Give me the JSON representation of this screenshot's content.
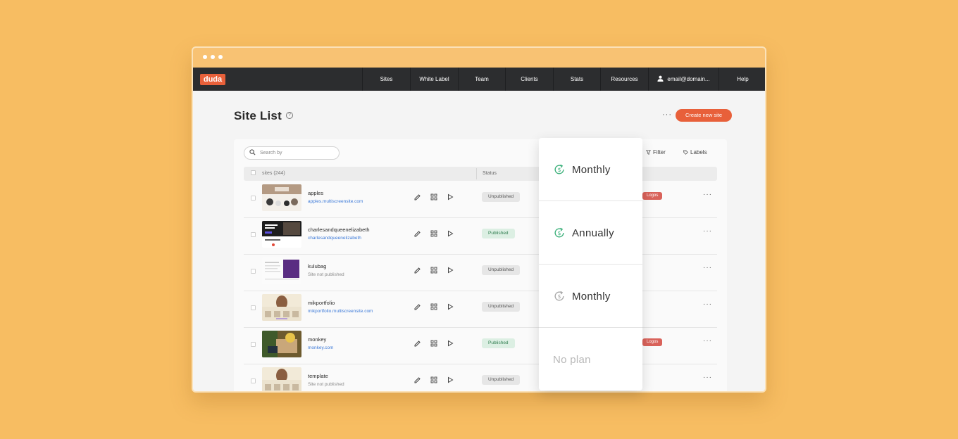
{
  "app": {
    "logo": "duda"
  },
  "nav": {
    "items": [
      "Sites",
      "White Label",
      "Team",
      "Clients",
      "Stats",
      "Resources"
    ],
    "account": "email@domain...",
    "help": "Help"
  },
  "page": {
    "title": "Site List",
    "help_glyph": "?",
    "more_glyph": "···",
    "create_button": "Create new site"
  },
  "toolbar": {
    "search_placeholder": "Search by",
    "filter": "Filter",
    "labels": "Labels"
  },
  "table": {
    "col_sites": "sites (244)",
    "col_status": "Status",
    "rows": [
      {
        "name": "apples",
        "url": "apples.multiscreensite.com",
        "url_muted": false,
        "status": "Unpublished",
        "published": false,
        "tag": "Logos",
        "thumb": "light-people"
      },
      {
        "name": "charlesandqueenelizabeth",
        "url": "charlesandqueenelizabeth",
        "url_muted": false,
        "status": "Published",
        "published": true,
        "tag": "",
        "thumb": "dark"
      },
      {
        "name": "kulubag",
        "url": "Site not published",
        "url_muted": true,
        "status": "Unpublished",
        "published": false,
        "tag": "",
        "thumb": "doc-purple"
      },
      {
        "name": "mikportfolio",
        "url": "mikportfolio.multiscreensite.com",
        "url_muted": false,
        "status": "Unpublished",
        "published": false,
        "tag": "",
        "thumb": "portrait"
      },
      {
        "name": "monkey",
        "url": "monkey.com",
        "url_muted": false,
        "status": "Published",
        "published": true,
        "tag": "Logos",
        "thumb": "photo"
      },
      {
        "name": "template",
        "url": "Site not published",
        "url_muted": true,
        "status": "Unpublished",
        "published": false,
        "tag": "",
        "thumb": "portrait"
      }
    ],
    "row_more_glyph": "···"
  },
  "plan_dropdown": {
    "options": [
      {
        "label": "Monthly",
        "icon": "recurring-payment-icon",
        "icon_color": "#3bb07a",
        "enabled": true
      },
      {
        "label": "Annually",
        "icon": "recurring-payment-icon",
        "icon_color": "#3bb07a",
        "enabled": true
      },
      {
        "label": "Monthly",
        "icon": "recurring-payment-icon",
        "icon_color": "#a8a8a8",
        "enabled": true
      },
      {
        "label": "No plan",
        "icon": "",
        "icon_color": "",
        "enabled": false
      }
    ]
  },
  "colors": {
    "background": "#f7bd62",
    "accent": "#e8603a",
    "nav": "#2c2d2f",
    "tag": "#d9625a"
  }
}
